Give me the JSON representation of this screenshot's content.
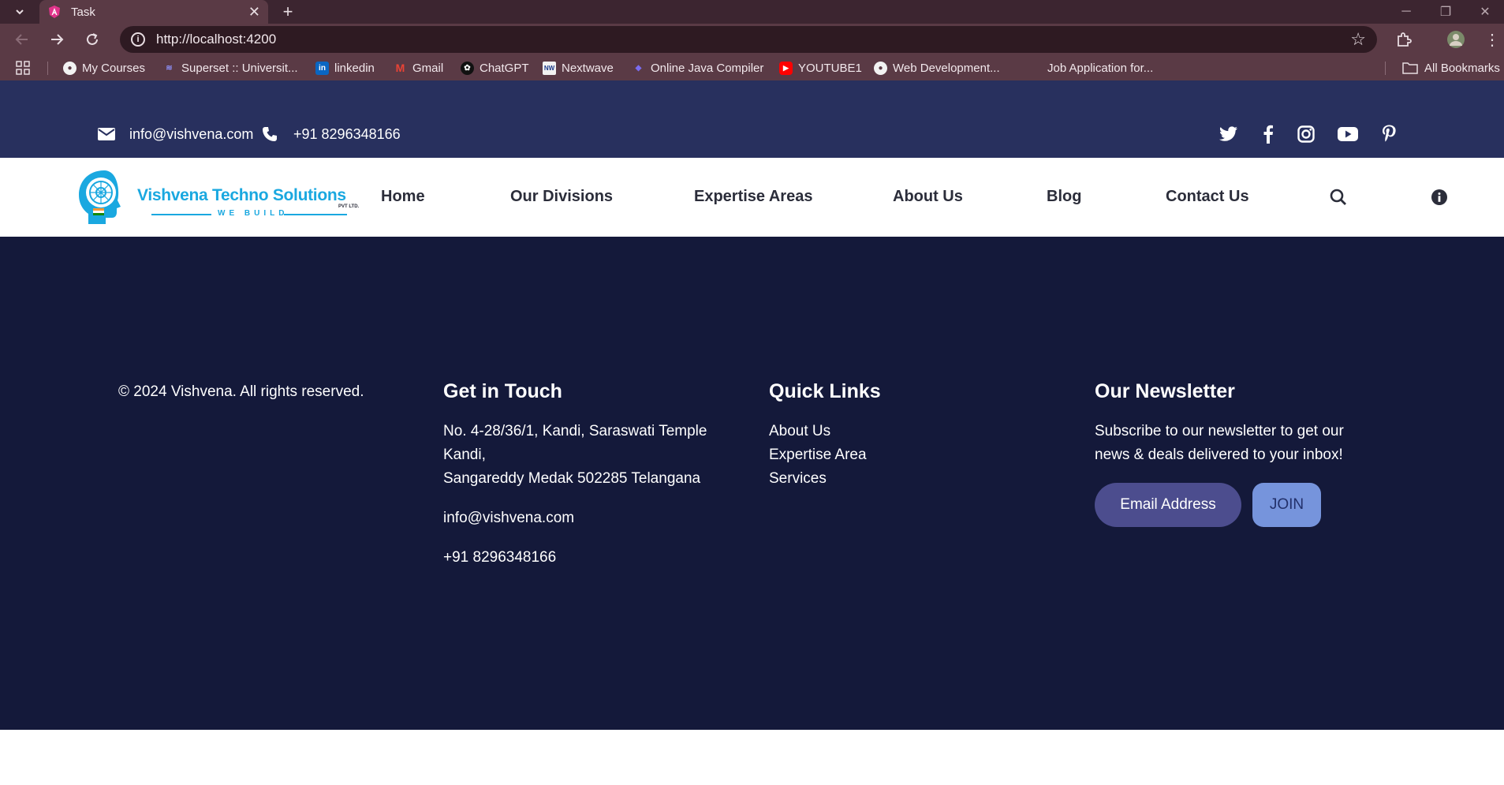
{
  "browser": {
    "tab_title": "Task",
    "url": "http://localhost:4200",
    "bookmarks": [
      {
        "label": "My Courses"
      },
      {
        "label": "Superset :: Universit..."
      },
      {
        "label": "linkedin"
      },
      {
        "label": "Gmail"
      },
      {
        "label": "ChatGPT"
      },
      {
        "label": "Nextwave"
      },
      {
        "label": "Online Java Compiler"
      },
      {
        "label": "YOUTUBE1"
      },
      {
        "label": "Web Development..."
      },
      {
        "label": "Job Application for..."
      }
    ],
    "all_bookmarks": "All Bookmarks"
  },
  "topbar": {
    "email": "info@vishvena.com",
    "phone": "+91 8296348166",
    "background": "#28305e"
  },
  "navbar": {
    "logo": {
      "name": "Vishvena Techno Solutions",
      "suffix": "PVT LTD.",
      "tagline": "WE BUILD"
    },
    "links": [
      "Home",
      "Our Divisions",
      "Expertise Areas",
      "About Us",
      "Blog",
      "Contact Us"
    ]
  },
  "footer": {
    "background": "#14193a",
    "copyright": "© 2024 Vishvena. All rights reserved.",
    "get_in_touch": {
      "title": "Get in Touch",
      "address_line1": "No. 4-28/36/1, Kandi, Saraswati Temple",
      "address_line2": "Kandi,",
      "address_line3": "Sangareddy Medak 502285 Telangana",
      "email": "info@vishvena.com",
      "phone": "+91 8296348166"
    },
    "quick_links": {
      "title": "Quick Links",
      "items": [
        "About Us",
        "Expertise Area",
        "Services"
      ]
    },
    "newsletter": {
      "title": "Our Newsletter",
      "text_line1": "Subscribe to our newsletter to get our",
      "text_line2": "news & deals delivered to your inbox!",
      "input_placeholder": "Email Address",
      "button": "JOIN"
    }
  }
}
